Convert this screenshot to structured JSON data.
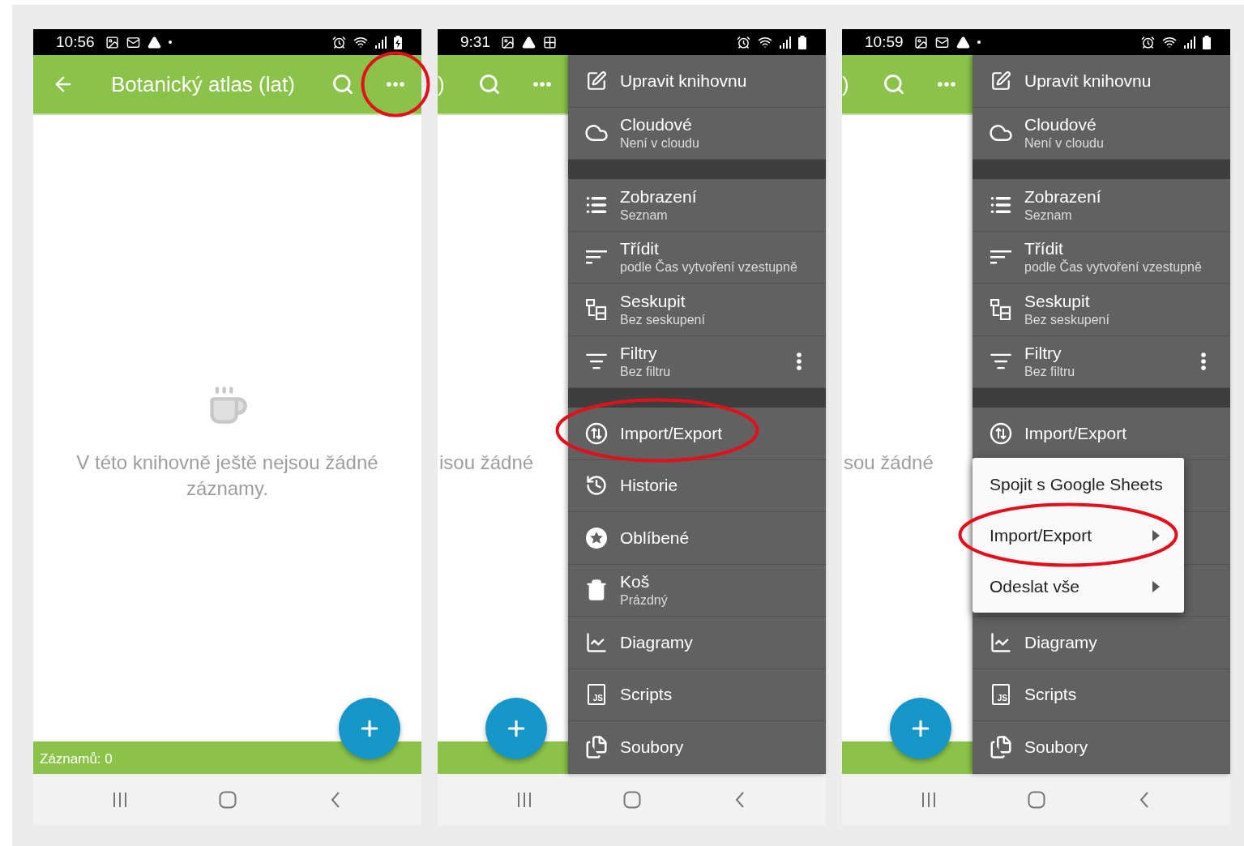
{
  "phones": [
    {
      "status_bar": {
        "time": "10:56",
        "notifications": [
          {
            "kind": "image"
          },
          {
            "kind": "mail"
          },
          {
            "kind": "warning"
          },
          {
            "kind": "dot"
          }
        ],
        "charging": true
      },
      "app_bar": {
        "title": "Botanický atlas (lat)",
        "back": true,
        "menu_circled": true
      },
      "empty_state": {
        "icon": true,
        "text": "V této knihovně ještě nejsou žádné záznamy."
      },
      "footer": {
        "count": "Záznamů: 0"
      }
    },
    {
      "status_bar": {
        "time": "9:31",
        "notifications": [
          {
            "kind": "image"
          },
          {
            "kind": "warning"
          },
          {
            "kind": "grid"
          }
        ],
        "charging": false
      },
      "app_bar": {
        "title": ")",
        "back": false,
        "menu_circled": false
      },
      "empty_state": {
        "icon": false,
        "text": "isou žádné"
      },
      "drawer": {
        "groups": [
          {
            "items": [
              {
                "kind": "entry",
                "label": "Upravit knihovnu",
                "circled": false
              },
              {
                "kind": "entry",
                "label": "Cloudové",
                "sublabel": "Není v cloudu",
                "circled": false
              }
            ]
          },
          {
            "items": [
              {
                "kind": "entry",
                "label": "Zobrazení",
                "sublabel": "Seznam",
                "circled": false
              },
              {
                "kind": "entry",
                "label": "Třídit",
                "sublabel": "podle Čas vytvoření vzestupně",
                "circled": false
              },
              {
                "kind": "entry",
                "label": "Seskupit",
                "sublabel": "Bez seskupení",
                "circled": false
              },
              {
                "kind": "entry-with-menu",
                "label": "Filtry",
                "sublabel": "Bez filtru",
                "circled": false
              }
            ]
          },
          {
            "items": [
              {
                "kind": "entry",
                "label": "Import/Export",
                "circled": true
              },
              {
                "kind": "entry",
                "label": "Historie",
                "circled": false
              },
              {
                "kind": "entry",
                "label": "Oblíbené",
                "circled": false
              },
              {
                "kind": "entry",
                "label": "Koš",
                "sublabel": "Prázdný",
                "circled": false
              },
              {
                "kind": "entry",
                "label": "Diagramy",
                "circled": false
              },
              {
                "kind": "entry",
                "label": "Scripts",
                "icon_text": "JS",
                "circled": false
              },
              {
                "kind": "entry",
                "label": "Soubory",
                "circled": false
              }
            ]
          }
        ]
      }
    },
    {
      "status_bar": {
        "time": "10:59",
        "notifications": [
          {
            "kind": "image"
          },
          {
            "kind": "mail"
          },
          {
            "kind": "warning"
          },
          {
            "kind": "dot"
          }
        ],
        "charging": false
      },
      "app_bar": {
        "title": ")",
        "back": false,
        "menu_circled": false
      },
      "empty_state": {
        "icon": false,
        "text": "sou žádné"
      },
      "drawer": {
        "groups": [
          {
            "items": [
              {
                "kind": "entry",
                "label": "Upravit knihovnu",
                "circled": false
              },
              {
                "kind": "entry",
                "label": "Cloudové",
                "sublabel": "Není v cloudu",
                "circled": false
              }
            ]
          },
          {
            "items": [
              {
                "kind": "entry",
                "label": "Zobrazení",
                "sublabel": "Seznam",
                "circled": false
              },
              {
                "kind": "entry",
                "label": "Třídit",
                "sublabel": "podle Čas vytvoření vzestupně",
                "circled": false
              },
              {
                "kind": "entry",
                "label": "Seskupit",
                "sublabel": "Bez seskupení",
                "circled": false
              },
              {
                "kind": "entry-with-menu",
                "label": "Filtry",
                "sublabel": "Bez filtru",
                "circled": false
              }
            ]
          },
          {
            "items": [
              {
                "kind": "entry",
                "label": "Import/Export",
                "circled": false
              },
              {
                "kind": "covered"
              },
              {
                "kind": "covered"
              },
              {
                "kind": "covered"
              },
              {
                "kind": "entry",
                "label": "Diagramy",
                "circled": false
              },
              {
                "kind": "entry",
                "label": "Scripts",
                "icon_text": "JS",
                "circled": false
              },
              {
                "kind": "entry",
                "label": "Soubory",
                "circled": false
              }
            ]
          }
        ],
        "popup": {
          "items": [
            {
              "label": "Spojit s Google Sheets",
              "submenu": false,
              "circled": false
            },
            {
              "label": "Import/Export",
              "submenu": true,
              "circled": true
            },
            {
              "label": "Odeslat vše",
              "submenu": true,
              "circled": false
            }
          ]
        }
      }
    }
  ]
}
